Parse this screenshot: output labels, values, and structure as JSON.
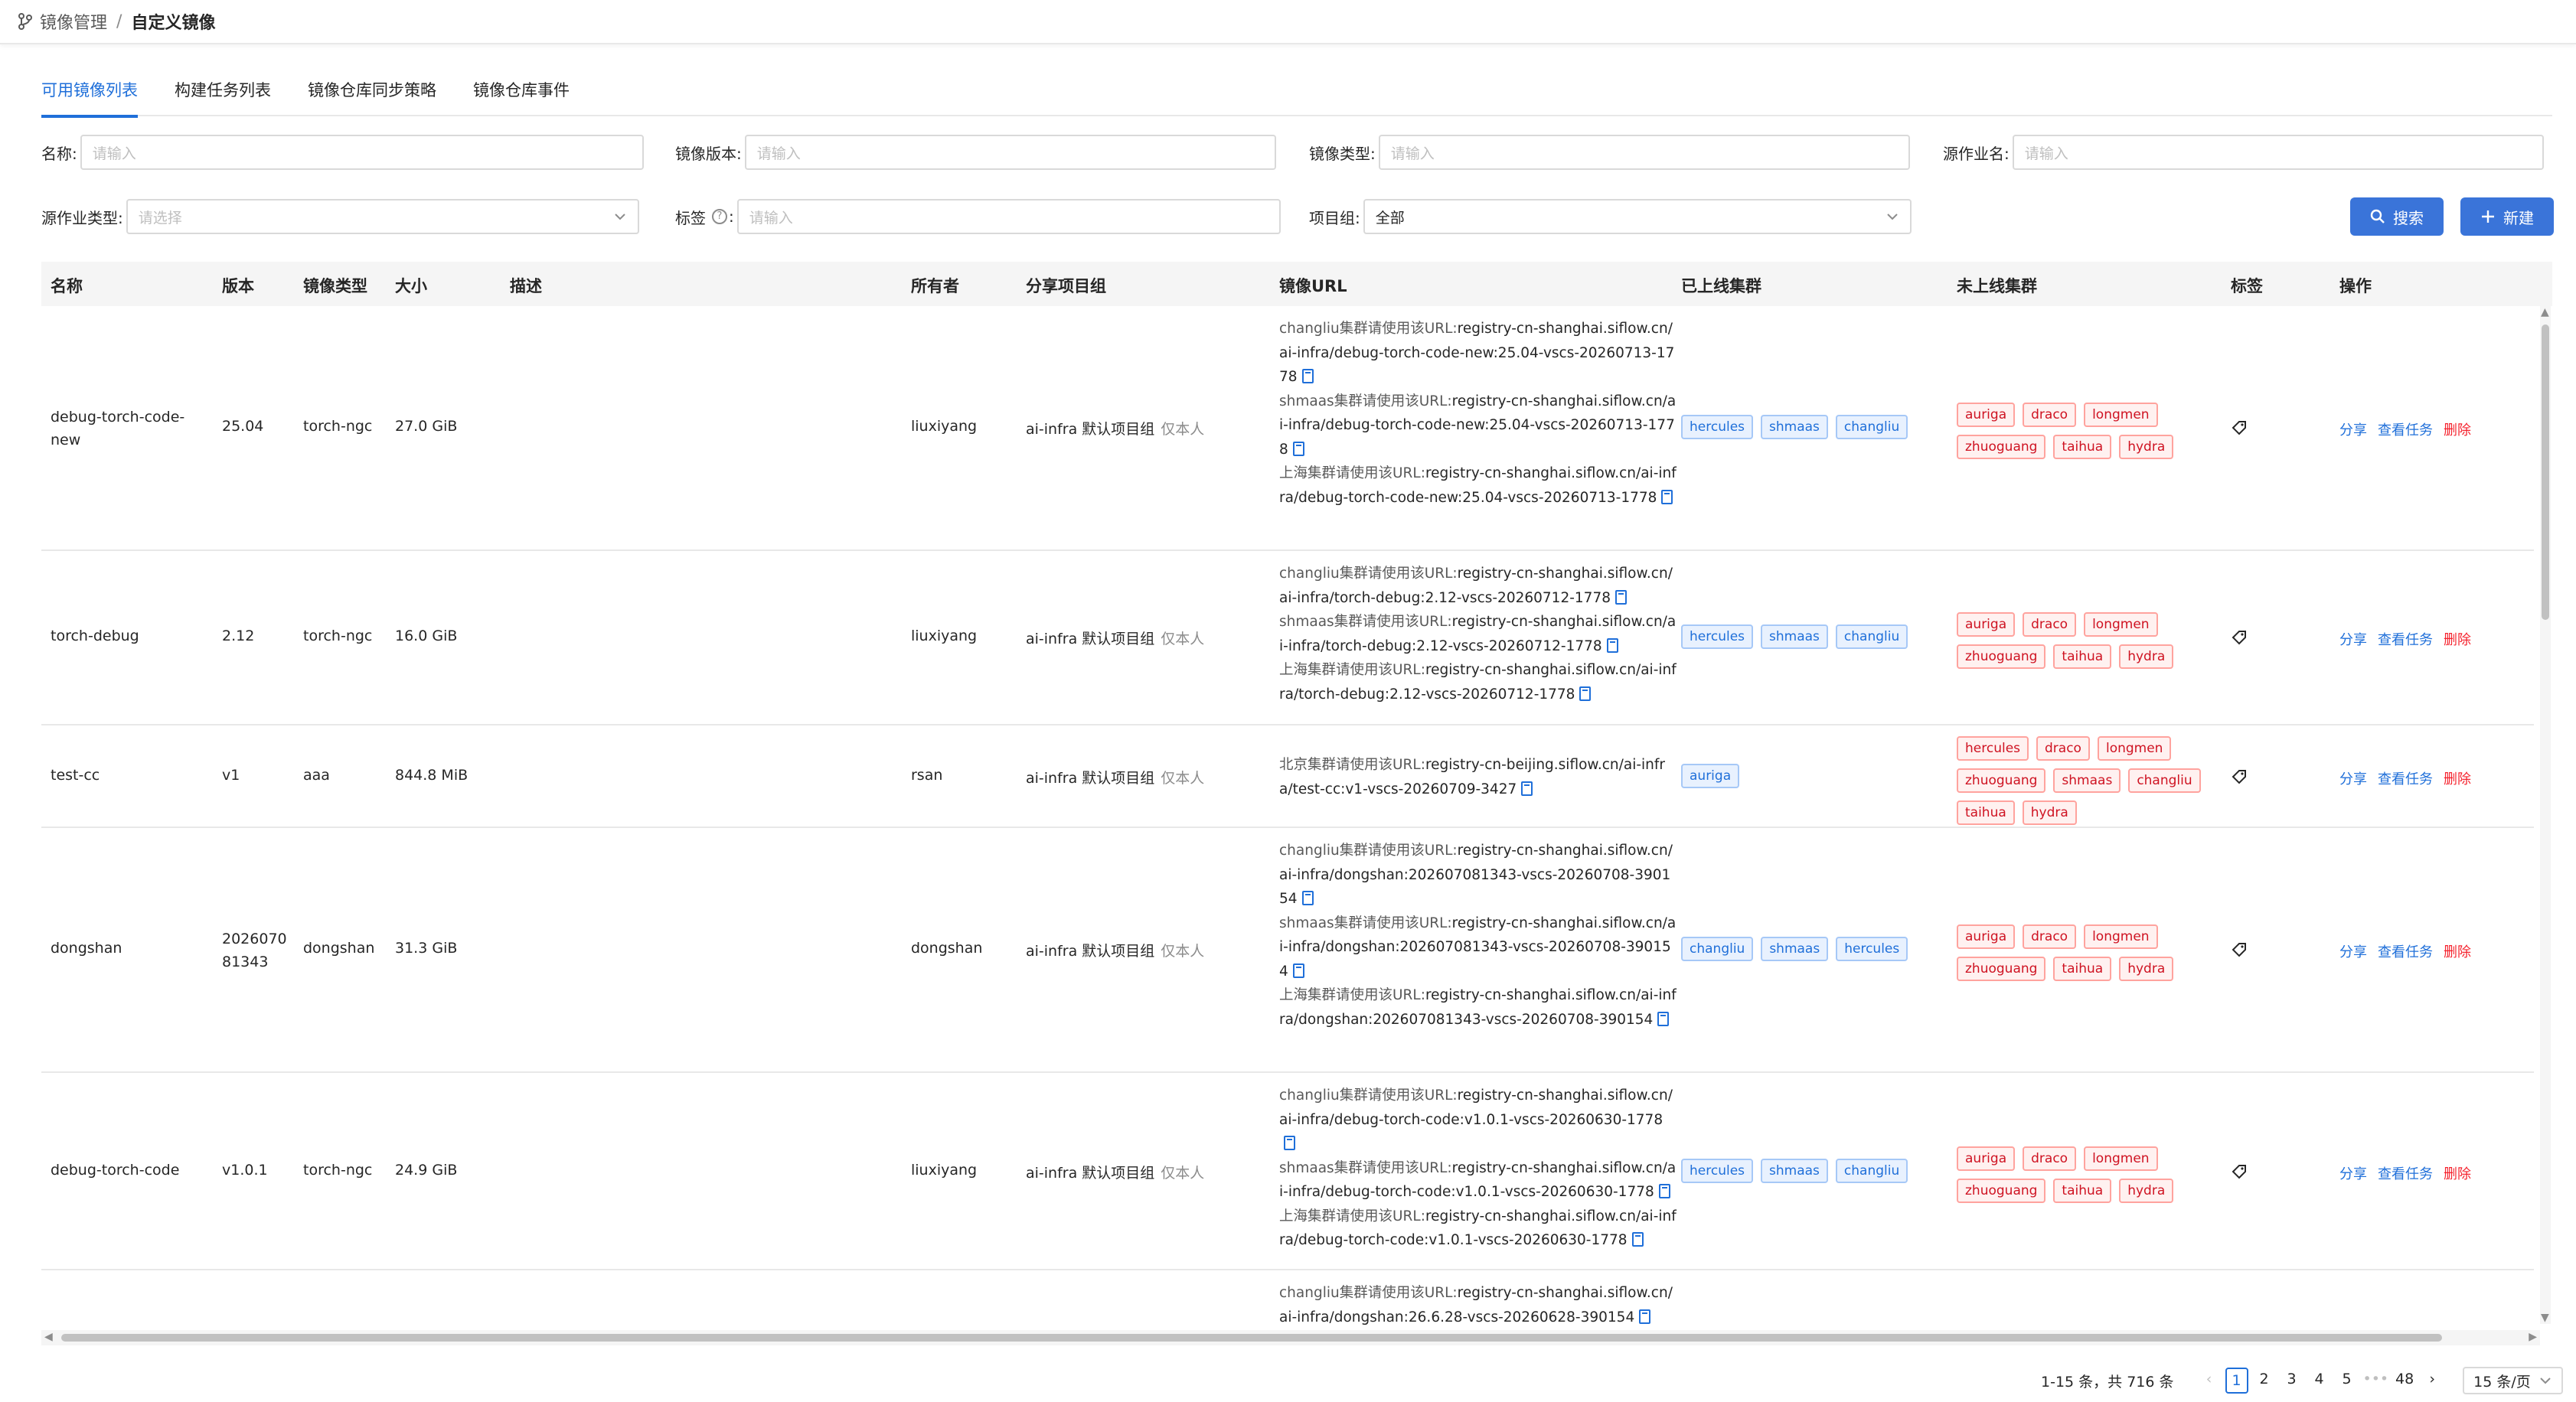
{
  "breadcrumb": {
    "parent": "镜像管理",
    "separator": "/",
    "current": "自定义镜像"
  },
  "tabs": [
    {
      "label": "可用镜像列表",
      "active": true
    },
    {
      "label": "构建任务列表",
      "active": false
    },
    {
      "label": "镜像仓库同步策略",
      "active": false
    },
    {
      "label": "镜像仓库事件",
      "active": false
    }
  ],
  "filters": {
    "name": {
      "label": "名称:",
      "placeholder": "请输入"
    },
    "version": {
      "label": "镜像版本:",
      "placeholder": "请输入"
    },
    "type": {
      "label": "镜像类型:",
      "placeholder": "请输入"
    },
    "job_name": {
      "label": "源作业名:",
      "placeholder": "请输入"
    },
    "job_type": {
      "label": "源作业类型:",
      "placeholder": "请选择"
    },
    "tags": {
      "label": "标签",
      "placeholder": "请输入"
    },
    "project": {
      "label": "项目组:",
      "value": "全部"
    }
  },
  "buttons": {
    "search": "搜索",
    "create": "新建"
  },
  "columns": [
    "名称",
    "版本",
    "镜像类型",
    "大小",
    "描述",
    "所有者",
    "分享项目组",
    "镜像URL",
    "已上线集群",
    "未上线集群",
    "标签",
    "操作"
  ],
  "actions": {
    "share": "分享",
    "view_tasks": "查看任务",
    "delete": "删除"
  },
  "rows": [
    {
      "name": "debug-torch-code-new",
      "version": "25.04",
      "type": "torch-ngc",
      "size": "27.0 GiB",
      "owner": "liuxiyang",
      "share": "ai-infra 默认项目组",
      "share_note": "仅本人",
      "urls": [
        {
          "prefix": "changliu集群请使用该URL:",
          "url": "registry-cn-shanghai.siflow.cn/ai-infra/debug-torch-code-new:25.04-vscs-20260713-1778"
        },
        {
          "prefix": "shmaas集群请使用该URL:",
          "url": "registry-cn-shanghai.siflow.cn/ai-infra/debug-torch-code-new:25.04-vscs-20260713-1778"
        },
        {
          "prefix": "上海集群请使用该URL:",
          "url": "registry-cn-shanghai.siflow.cn/ai-infra/debug-torch-code-new:25.04-vscs-20260713-1778"
        }
      ],
      "online": [
        "hercules",
        "shmaas",
        "changliu"
      ],
      "offline": [
        "auriga",
        "draco",
        "longmen",
        "zhuoguang",
        "taihua",
        "hydra"
      ]
    },
    {
      "name": "torch-debug",
      "version": "2.12",
      "type": "torch-ngc",
      "size": "16.0 GiB",
      "owner": "liuxiyang",
      "share": "ai-infra 默认项目组",
      "share_note": "仅本人",
      "urls": [
        {
          "prefix": "changliu集群请使用该URL:",
          "url": "registry-cn-shanghai.siflow.cn/ai-infra/torch-debug:2.12-vscs-20260712-1778"
        },
        {
          "prefix": "shmaas集群请使用该URL:",
          "url": "registry-cn-shanghai.siflow.cn/ai-infra/torch-debug:2.12-vscs-20260712-1778"
        },
        {
          "prefix": "上海集群请使用该URL:",
          "url": "registry-cn-shanghai.siflow.cn/ai-infra/torch-debug:2.12-vscs-20260712-1778"
        }
      ],
      "online": [
        "hercules",
        "shmaas",
        "changliu"
      ],
      "offline": [
        "auriga",
        "draco",
        "longmen",
        "zhuoguang",
        "taihua",
        "hydra"
      ]
    },
    {
      "name": "test-cc",
      "version": "v1",
      "type": "aaa",
      "size": "844.8 MiB",
      "owner": "rsan",
      "share": "ai-infra 默认项目组",
      "share_note": "仅本人",
      "urls": [
        {
          "prefix": "北京集群请使用该URL:",
          "url": "registry-cn-beijing.siflow.cn/ai-infra/test-cc:v1-vscs-20260709-3427"
        }
      ],
      "online": [
        "auriga"
      ],
      "offline": [
        "hercules",
        "draco",
        "longmen",
        "zhuoguang",
        "shmaas",
        "changliu",
        "taihua",
        "hydra"
      ]
    },
    {
      "name": "dongshan",
      "version": "202607081343",
      "type": "dongshan",
      "size": "31.3 GiB",
      "owner": "dongshan",
      "share": "ai-infra 默认项目组",
      "share_note": "仅本人",
      "urls": [
        {
          "prefix": "changliu集群请使用该URL:",
          "url": "registry-cn-shanghai.siflow.cn/ai-infra/dongshan:202607081343-vscs-20260708-390154"
        },
        {
          "prefix": "shmaas集群请使用该URL:",
          "url": "registry-cn-shanghai.siflow.cn/ai-infra/dongshan:202607081343-vscs-20260708-390154"
        },
        {
          "prefix": "上海集群请使用该URL:",
          "url": "registry-cn-shanghai.siflow.cn/ai-infra/dongshan:202607081343-vscs-20260708-390154"
        }
      ],
      "online": [
        "changliu",
        "shmaas",
        "hercules"
      ],
      "offline": [
        "auriga",
        "draco",
        "longmen",
        "zhuoguang",
        "taihua",
        "hydra"
      ]
    },
    {
      "name": "debug-torch-code",
      "version": "v1.0.1",
      "type": "torch-ngc",
      "size": "24.9 GiB",
      "owner": "liuxiyang",
      "share": "ai-infra 默认项目组",
      "share_note": "仅本人",
      "urls": [
        {
          "prefix": "changliu集群请使用该URL:",
          "url": "registry-cn-shanghai.siflow.cn/ai-infra/debug-torch-code:v1.0.1-vscs-20260630-1778"
        },
        {
          "prefix": "shmaas集群请使用该URL:",
          "url": "registry-cn-shanghai.siflow.cn/ai-infra/debug-torch-code:v1.0.1-vscs-20260630-1778"
        },
        {
          "prefix": "上海集群请使用该URL:",
          "url": "registry-cn-shanghai.siflow.cn/ai-infra/debug-torch-code:v1.0.1-vscs-20260630-1778"
        }
      ],
      "online": [
        "hercules",
        "shmaas",
        "changliu"
      ],
      "offline": [
        "auriga",
        "draco",
        "longmen",
        "zhuoguang",
        "taihua",
        "hydra"
      ]
    },
    {
      "name": "",
      "version": "",
      "type": "",
      "size": "",
      "owner": "",
      "share": "",
      "share_note": "",
      "urls": [
        {
          "prefix": "changliu集群请使用该URL:",
          "url": "registry-cn-shanghai.siflow.cn/ai-infra/dongshan:26.6.28-vscs-20260628-390154"
        }
      ],
      "online": [],
      "offline": []
    }
  ],
  "pagination": {
    "total": "1-15 条，共 716 条",
    "pages": [
      "1",
      "2",
      "3",
      "4",
      "5"
    ],
    "ellipsis": "•••",
    "last": "48",
    "page_size": "15 条/页"
  }
}
